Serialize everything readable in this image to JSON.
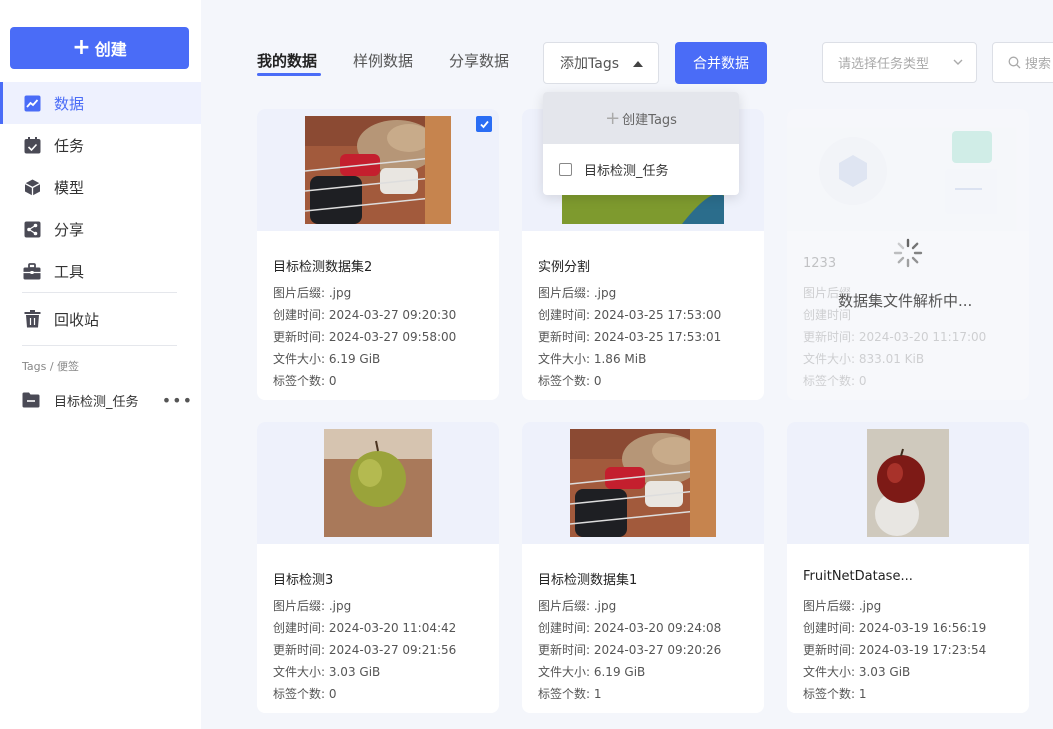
{
  "sidebar": {
    "create_label": "创建",
    "nav": [
      {
        "label": "数据",
        "icon": "chart-icon"
      },
      {
        "label": "任务",
        "icon": "calendar-icon"
      },
      {
        "label": "模型",
        "icon": "cube-icon"
      },
      {
        "label": "分享",
        "icon": "share-icon"
      },
      {
        "label": "工具",
        "icon": "toolbox-icon"
      },
      {
        "label": "回收站",
        "icon": "trash-icon"
      }
    ],
    "tags_title": "Tags / 便签",
    "tags": [
      {
        "label": "目标检测_任务",
        "more": "•••"
      }
    ]
  },
  "header": {
    "tabs": [
      "我的数据",
      "样例数据",
      "分享数据"
    ],
    "tags_dropdown_label": "添加Tags",
    "merge_label": "合并数据",
    "type_placeholder": "请选择任务类型",
    "search_placeholder": "搜索"
  },
  "tags_popup": {
    "create_label": "创建Tags",
    "options": [
      {
        "label": "目标检测_任务",
        "checked": false
      }
    ]
  },
  "loading_text": "数据集文件解析中...",
  "cards": [
    {
      "name": "目标检测数据集2",
      "suffix": "图片后缀: .jpg",
      "created": "创建时间: 2024-03-27 09:20:30",
      "updated": "更新时间: 2024-03-27 09:58:00",
      "size": "文件大小: 6.19 GiB",
      "tags": "标签个数: 0",
      "selected": true
    },
    {
      "name": "实例分割",
      "suffix": "图片后缀: .jpg",
      "created": "创建时间: 2024-03-25 17:53:00",
      "updated": "更新时间: 2024-03-25 17:53:01",
      "size": "文件大小: 1.86 MiB",
      "tags": "标签个数: 0"
    },
    {
      "name": "1233",
      "suffix": "图片后缀",
      "created": "创建时间",
      "updated": "更新时间: 2024-03-20 11:17:00",
      "size": "文件大小: 833.01 KiB",
      "tags": "标签个数: 0",
      "loading": true
    },
    {
      "name": "目标检测3",
      "suffix": "图片后缀: .jpg",
      "created": "创建时间: 2024-03-20 11:04:42",
      "updated": "更新时间: 2024-03-27 09:21:56",
      "size": "文件大小: 3.03 GiB",
      "tags": "标签个数: 0"
    },
    {
      "name": "目标检测数据集1",
      "suffix": "图片后缀: .jpg",
      "created": "创建时间: 2024-03-20 09:24:08",
      "updated": "更新时间: 2024-03-27 09:20:26",
      "size": "文件大小: 6.19 GiB",
      "tags": "标签个数: 1"
    },
    {
      "name": "FruitNetDatase...",
      "suffix": "图片后缀: .jpg",
      "created": "创建时间: 2024-03-19 16:56:19",
      "updated": "更新时间: 2024-03-19 17:23:54",
      "size": "文件大小: 3.03 GiB",
      "tags": "标签个数: 1"
    }
  ],
  "colors": {
    "accent": "#4a6cf7",
    "page_bg": "#f4f6fb",
    "thumb_bg": "#eef1fb"
  }
}
